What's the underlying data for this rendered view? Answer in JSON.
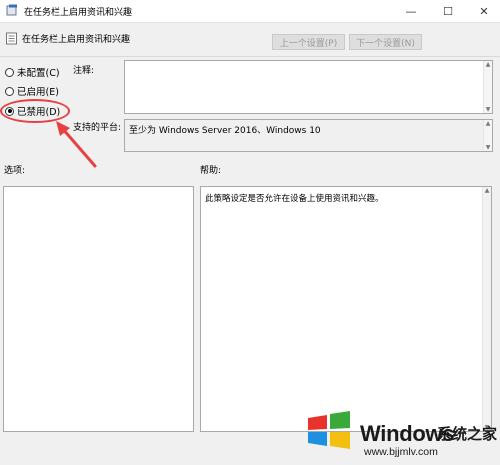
{
  "window": {
    "title": "在任务栏上启用资讯和兴趣",
    "controls": {
      "minimize": "—",
      "maximize": "☐",
      "close": "✕"
    }
  },
  "header": {
    "policy_title": "在任务栏上启用资讯和兴趣",
    "prev_button": "上一个设置(P)",
    "next_button": "下一个设置(N)"
  },
  "state_options": [
    {
      "label": "未配置(C)",
      "selected": false
    },
    {
      "label": "已启用(E)",
      "selected": false
    },
    {
      "label": "已禁用(D)",
      "selected": true
    }
  ],
  "comment": {
    "label": "注释:",
    "value": ""
  },
  "platform": {
    "label": "支持的平台:",
    "value": "至少为 Windows Server 2016、Windows 10"
  },
  "options_label": "选项:",
  "help": {
    "label": "帮助:",
    "text": "此策略设定是否允许在设备上使用资讯和兴趣。"
  },
  "watermark": {
    "brand": "Windows",
    "cn": "系统之家",
    "url": "www.bjjmlv.com"
  },
  "colors": {
    "annotation": "#e64040",
    "disabled_text": "#9b9b9b"
  }
}
